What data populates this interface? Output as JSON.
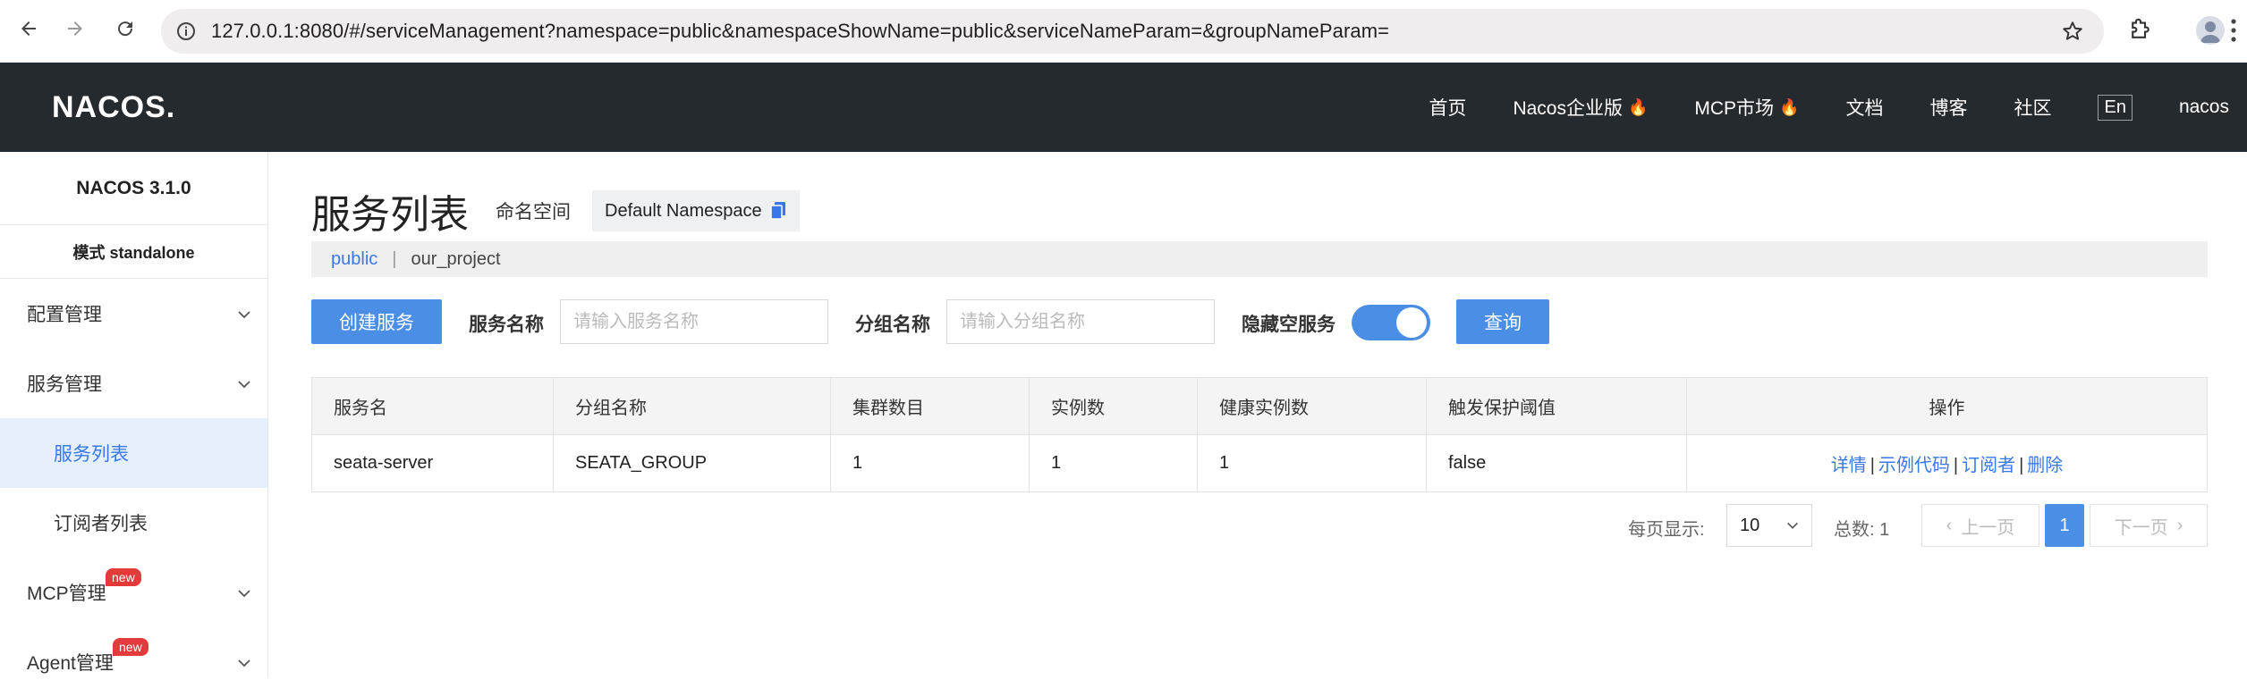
{
  "browser": {
    "url": "127.0.0.1:8080/#/serviceManagement?namespace=public&namespaceShowName=public&serviceNameParam=&groupNameParam="
  },
  "header": {
    "logo": "NACOS.",
    "nav": [
      {
        "label": "首页",
        "hot": false
      },
      {
        "label": "Nacos企业版",
        "hot": true
      },
      {
        "label": "MCP市场",
        "hot": true
      },
      {
        "label": "文档",
        "hot": false
      },
      {
        "label": "博客",
        "hot": false
      },
      {
        "label": "社区",
        "hot": false
      }
    ],
    "lang": "En",
    "user": "nacos"
  },
  "sidebar": {
    "version": "NACOS 3.1.0",
    "mode": "模式 standalone",
    "groups": [
      {
        "label": "配置管理"
      },
      {
        "label": "服务管理",
        "children": [
          {
            "label": "服务列表",
            "active": true
          },
          {
            "label": "订阅者列表",
            "active": false
          }
        ]
      },
      {
        "label": "MCP管理",
        "badge": "new"
      },
      {
        "label": "Agent管理",
        "badge": "new"
      }
    ]
  },
  "main": {
    "title": "服务列表",
    "namespace_label": "命名空间",
    "namespace_name": "Default Namespace",
    "namespaces": [
      "public",
      "our_project"
    ],
    "create_button": "创建服务",
    "service_name_label": "服务名称",
    "service_name_placeholder": "请输入服务名称",
    "group_name_label": "分组名称",
    "group_name_placeholder": "请输入分组名称",
    "hide_empty_label": "隐藏空服务",
    "hide_empty_on": true,
    "query_button": "查询",
    "table": {
      "columns": [
        "服务名",
        "分组名称",
        "集群数目",
        "实例数",
        "健康实例数",
        "触发保护阈值",
        "操作"
      ],
      "rows": [
        {
          "service": "seata-server",
          "group": "SEATA_GROUP",
          "clusters": "1",
          "instances": "1",
          "healthy": "1",
          "threshold": "false",
          "ops": [
            "详情",
            "示例代码",
            "订阅者",
            "删除"
          ]
        }
      ]
    },
    "pagination": {
      "page_size_label": "每页显示:",
      "page_size": "10",
      "total_label": "总数: 1",
      "prev": "上一页",
      "next": "下一页",
      "current_page": "1"
    }
  },
  "colors": {
    "header_bg": "#252a2f",
    "primary": "#4a8ee6",
    "link": "#3978e8",
    "active_bg": "#e5f0fc",
    "badge": "#e33b3b"
  }
}
